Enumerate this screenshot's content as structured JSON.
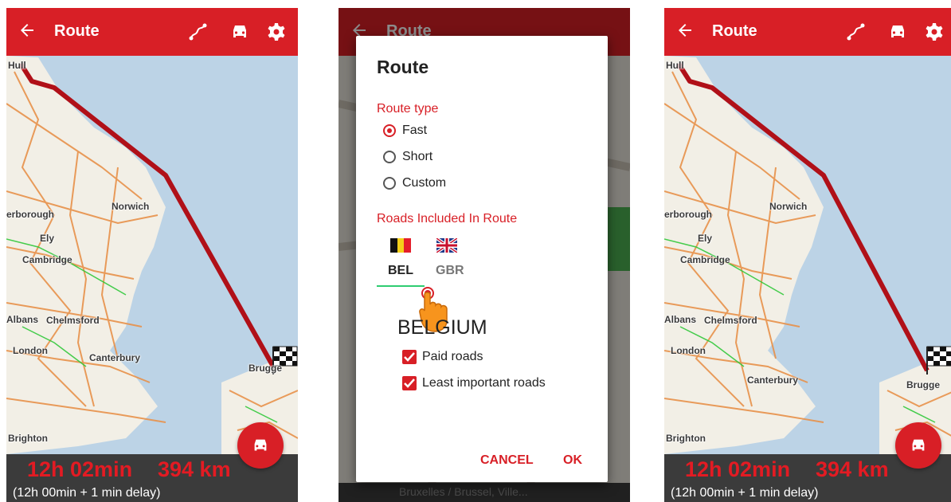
{
  "panels": [
    {
      "header": {
        "title": "Route",
        "back_icon": "arrow-left-icon",
        "icons": [
          "route-icon",
          "car-icon",
          "gear-icon"
        ]
      },
      "map": {
        "labels": [
          "Hull",
          "erborough",
          "Norwich",
          "Ely",
          "Cambridge",
          "Albans",
          "Chelmsford",
          "London",
          "Canterbury",
          "Brugge",
          "Brighton"
        ]
      },
      "summary": {
        "time": "12h 02min",
        "distance": "394 km",
        "delay": "(12h 00min + 1 min delay)"
      },
      "fab_icon": "car-icon"
    },
    {
      "background_header": {
        "title": "Route"
      },
      "dialog": {
        "title": "Route",
        "route_type_label": "Route type",
        "route_types": [
          {
            "label": "Fast",
            "selected": true
          },
          {
            "label": "Short",
            "selected": false
          },
          {
            "label": "Custom",
            "selected": false
          }
        ],
        "roads_label": "Roads Included In Route",
        "tabs": [
          {
            "code": "BEL",
            "flag": "belgium-flag-icon",
            "active": true
          },
          {
            "code": "GBR",
            "flag": "uk-flag-icon",
            "active": false
          }
        ],
        "country_name": "BELGIUM",
        "options": [
          {
            "label": "Paid roads",
            "checked": true
          },
          {
            "label": "Least important roads",
            "checked": true
          }
        ],
        "cancel_label": "CANCEL",
        "ok_label": "OK"
      },
      "background_address": "Bruxelles / Brussel, Ville..."
    },
    {
      "header": {
        "title": "Route",
        "back_icon": "arrow-left-icon",
        "icons": [
          "route-icon",
          "car-icon",
          "gear-icon"
        ]
      },
      "map": {
        "labels": [
          "Hull",
          "erborough",
          "Norwich",
          "Ely",
          "Cambridge",
          "Albans",
          "Chelmsford",
          "London",
          "Canterbury",
          "Brugge",
          "Brighton"
        ]
      },
      "summary": {
        "time": "12h 02min",
        "distance": "394 km",
        "delay": "(12h 00min + 1 min delay)"
      },
      "fab_icon": "car-icon"
    }
  ],
  "colors": {
    "accent": "#d81f26",
    "sea": "#bcd3e6",
    "land": "#f2efe6",
    "roads": "#e8914a",
    "route": "#b01018",
    "tab_indicator": "#2ecc71"
  }
}
